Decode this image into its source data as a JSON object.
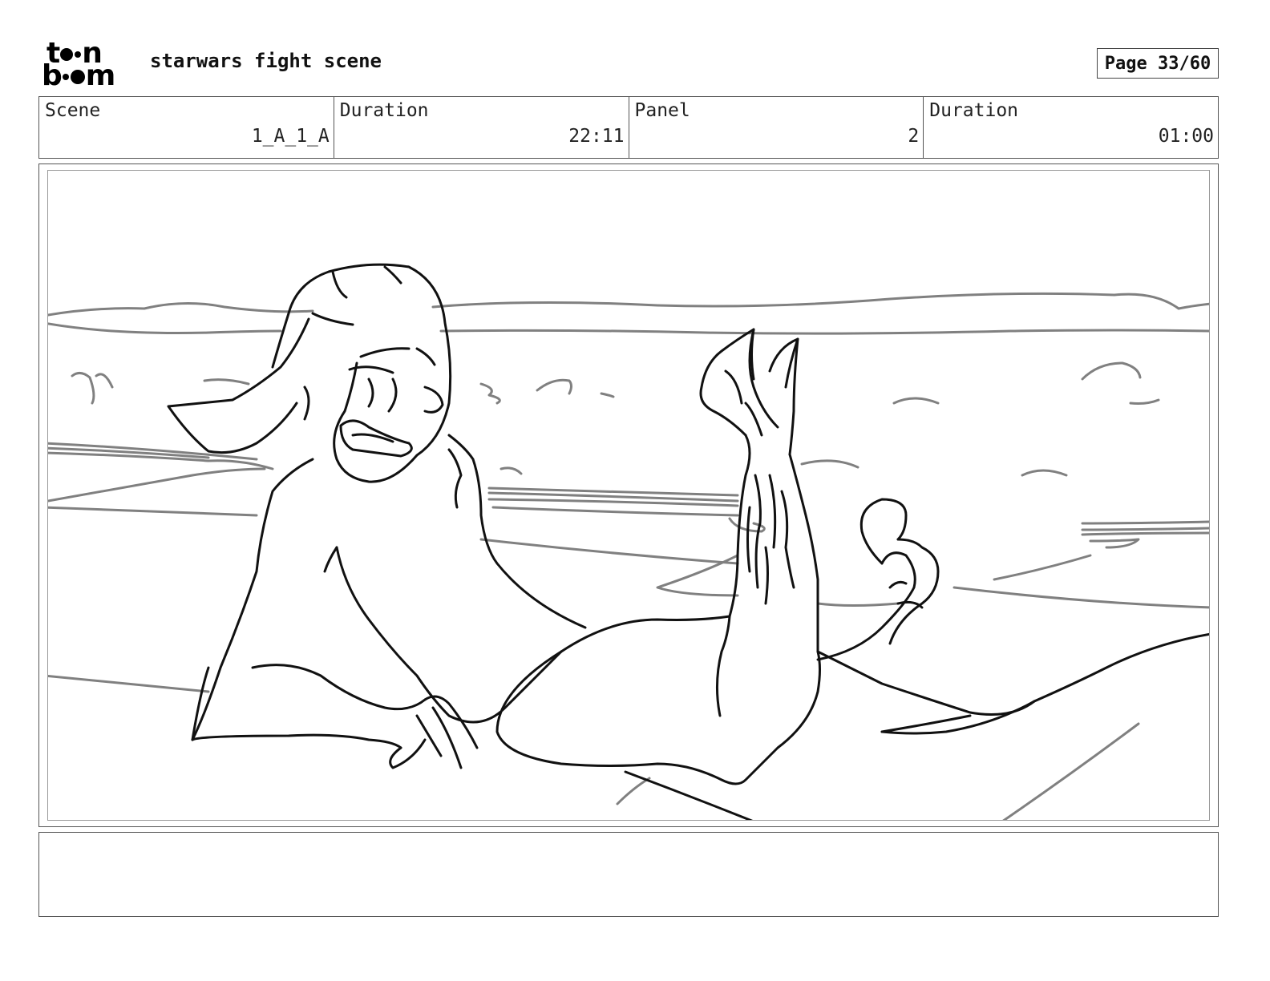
{
  "header": {
    "logo_top": [
      "t",
      "n"
    ],
    "logo_bottom": [
      "b",
      "m"
    ],
    "project_title": "starwars fight scene",
    "page_label": "Page 33/60"
  },
  "info": {
    "scene_label": "Scene",
    "scene_value": "1_A_1_A",
    "scene_duration_label": "Duration",
    "scene_duration_value": "22:11",
    "panel_label": "Panel",
    "panel_value": "2",
    "panel_duration_label": "Duration",
    "panel_duration_value": "01:00"
  },
  "panel": {
    "image": "storyboard-sketch-lying-character-on-beach"
  },
  "notes": {
    "text": ""
  },
  "colors": {
    "ink": "#111111",
    "sketch_gray": "#808080",
    "border": "#555555"
  }
}
